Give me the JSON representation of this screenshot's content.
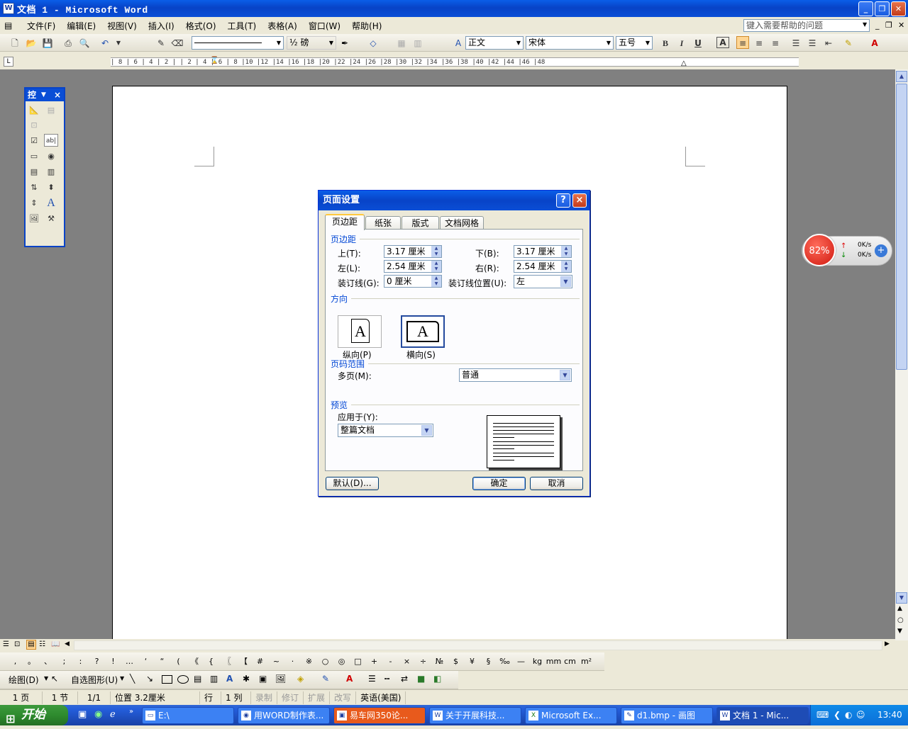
{
  "window": {
    "title": "文档 1 - Microsoft Word",
    "icon": "word-doc-icon"
  },
  "menu": {
    "items": [
      "文件(F)",
      "编辑(E)",
      "视图(V)",
      "插入(I)",
      "格式(O)",
      "工具(T)",
      "表格(A)",
      "窗口(W)",
      "帮助(H)"
    ],
    "help_placeholder": "键入需要帮助的问题"
  },
  "format_toolbar": {
    "line_weight": "½ 磅",
    "style": "正文",
    "font": "宋体",
    "size": "五号",
    "bold": "B",
    "italic": "I",
    "underline": "U"
  },
  "ruler": {
    "ticks": "| 8 | 6 | 4 | 2 |   | 2 | 4 | 6 | 8 |10 |12 |14 |16 |18 |20 |22 |24 |26 |28 |30 |32 |34 |36 |38 |40 |42 |44 |46 |48"
  },
  "control_toolbox": {
    "title": "控",
    "close": "×"
  },
  "speed_widget": {
    "percent": "82%",
    "up": "0K/s",
    "down": "0K/s"
  },
  "dialog": {
    "title": "页面设置",
    "help_btn": "?",
    "close_btn": "×",
    "tabs": [
      "页边距",
      "纸张",
      "版式",
      "文档网格"
    ],
    "margins_section": "页边距",
    "top_label": "上(T):",
    "top_value": "3.17 厘米",
    "bottom_label": "下(B):",
    "bottom_value": "3.17 厘米",
    "left_label": "左(L):",
    "left_value": "2.54 厘米",
    "right_label": "右(R):",
    "right_value": "2.54 厘米",
    "gutter_label": "装订线(G):",
    "gutter_value": "0 厘米",
    "gutter_pos_label": "装订线位置(U):",
    "gutter_pos_value": "左",
    "orientation_section": "方向",
    "portrait_label": "纵向(P)",
    "landscape_label": "横向(S)",
    "orientation_glyph": "A",
    "pages_section": "页码范围",
    "multi_label": "多页(M):",
    "multi_value": "普通",
    "preview_section": "预览",
    "apply_label": "应用于(Y):",
    "apply_value": "整篇文档",
    "default_btn": "默认(D)...",
    "ok_btn": "确定",
    "cancel_btn": "取消"
  },
  "symbols": [
    ",",
    "。",
    "、",
    ";",
    ":",
    "?",
    "!",
    "…",
    "‘",
    "“",
    "(",
    "《",
    "{",
    "〖",
    "【",
    "#",
    "~",
    "·",
    "※",
    "○",
    "◎",
    "□",
    "+",
    "-",
    "×",
    "÷",
    "№",
    "$",
    "¥",
    "§",
    "‰",
    "—",
    "kg",
    "mm",
    "cm",
    "m²"
  ],
  "draw_toolbar": {
    "draw": "绘图(D)",
    "autoshape": "自选图形(U)"
  },
  "status": {
    "page": "1 页",
    "section": "1 节",
    "pages": "1/1",
    "position": "位置 3.2厘米",
    "line": "行",
    "col": "1 列",
    "rec": "录制",
    "trk": "修订",
    "ext": "扩展",
    "ovr": "改写",
    "lang": "英语(美国)"
  },
  "taskbar": {
    "start": "开始",
    "tasks": [
      "E:\\",
      "用WORD制作表...",
      "易车网350论...",
      "关于开展科技...",
      "Microsoft Ex...",
      "d1.bmp - 画图",
      "文档 1 - Mic..."
    ],
    "clock": "13:40"
  }
}
